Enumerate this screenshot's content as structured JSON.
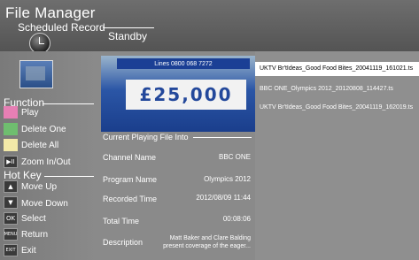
{
  "header": {
    "app_title": "File Manager",
    "subtitle": "Scheduled Record",
    "status": "Standby"
  },
  "left_panel": {
    "function_label": "Function",
    "functions": [
      {
        "label": "Play",
        "color": "#e67fb4"
      },
      {
        "label": "Delete One",
        "color": "#6fbe6f"
      },
      {
        "label": "Delete All",
        "color": "#f2e9a8"
      },
      {
        "label": "Zoom In/Out",
        "key": "▶II"
      }
    ],
    "hotkey_label": "Hot Key",
    "hotkeys": [
      {
        "key": "▲",
        "label": "Move Up"
      },
      {
        "key": "▼",
        "label": "Move Down"
      },
      {
        "key": "OK",
        "label": "Select"
      },
      {
        "key": "MENU",
        "label": "Return"
      },
      {
        "key": "EXIT",
        "label": "Exit"
      }
    ]
  },
  "preview": {
    "banner": "Lines 0800 068 7272",
    "amount": "£25,000"
  },
  "info": {
    "header": "Current Playing File Into",
    "channel_label": "Channel Name",
    "channel_value": "BBC ONE",
    "program_label": "Program Name",
    "program_value": "Olympics 2012",
    "recorded_label": "Recorded Time",
    "recorded_value": "2012/08/09 11:44",
    "total_label": "Total Time",
    "total_value": "00:08:06",
    "description_label": "Description",
    "description_line1": "Matt Baker and Clare Balding",
    "description_line2": "present coverage of the eager..."
  },
  "files": [
    {
      "name": "UKTV Br'tIdeas_Good Food Bites_20041119_161021.ts"
    },
    {
      "name": "BBC ONE_Olympics 2012_20120808_114427.ts"
    },
    {
      "name": "UKTV Br'tIdeas_Good Food Bites_20041119_162019.ts"
    }
  ]
}
